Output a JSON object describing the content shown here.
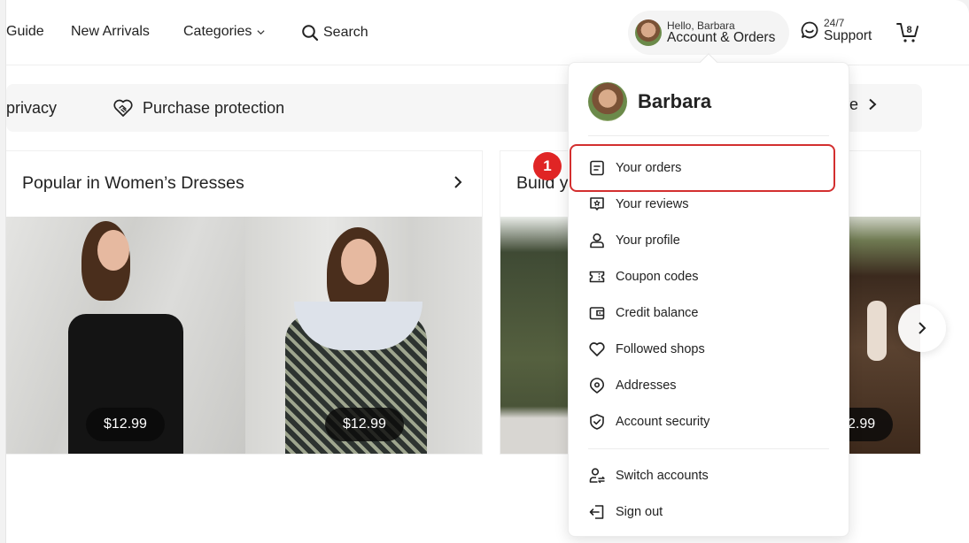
{
  "header": {
    "nav": [
      {
        "label": "Guide"
      },
      {
        "label": "New Arrivals"
      },
      {
        "label": "Categories",
        "icon": "chevron-down-icon"
      },
      {
        "label": "Search",
        "icon": "search-icon"
      }
    ],
    "account": {
      "greeting": "Hello, Barbara",
      "label": "Account & Orders",
      "icon": "avatar"
    },
    "support": {
      "hours": "24/7",
      "label": "Support",
      "icon": "chat-smile-icon"
    },
    "cart": {
      "count": "8",
      "icon": "cart-icon"
    }
  },
  "trust_banner": {
    "items": [
      {
        "label": "privacy"
      },
      {
        "label": "Purchase protection",
        "icon": "handshake-heart-icon"
      },
      {
        "label": "afe",
        "icon": "chevron-right-icon"
      }
    ]
  },
  "cards": [
    {
      "title": "Popular in Women’s Dresses",
      "products": [
        {
          "price": "$12.99"
        },
        {
          "price": "$12.99"
        }
      ]
    },
    {
      "title": "Build y",
      "products": [
        {
          "price": "2.99"
        }
      ]
    }
  ],
  "account_menu": {
    "name": "Barbara",
    "items": [
      {
        "label": "Your orders",
        "icon": "orders-icon",
        "highlighted": true
      },
      {
        "label": "Your reviews",
        "icon": "review-icon"
      },
      {
        "label": "Your profile",
        "icon": "profile-icon"
      },
      {
        "label": "Coupon codes",
        "icon": "coupon-icon"
      },
      {
        "label": "Credit balance",
        "icon": "wallet-icon"
      },
      {
        "label": "Followed shops",
        "icon": "heart-icon"
      },
      {
        "label": "Addresses",
        "icon": "location-icon"
      },
      {
        "label": "Account security",
        "icon": "shield-check-icon"
      }
    ],
    "footer_items": [
      {
        "label": "Switch accounts",
        "icon": "switch-account-icon"
      },
      {
        "label": "Sign out",
        "icon": "sign-out-icon"
      }
    ]
  },
  "annotation": {
    "step": "1",
    "color": "#d32f2f"
  }
}
